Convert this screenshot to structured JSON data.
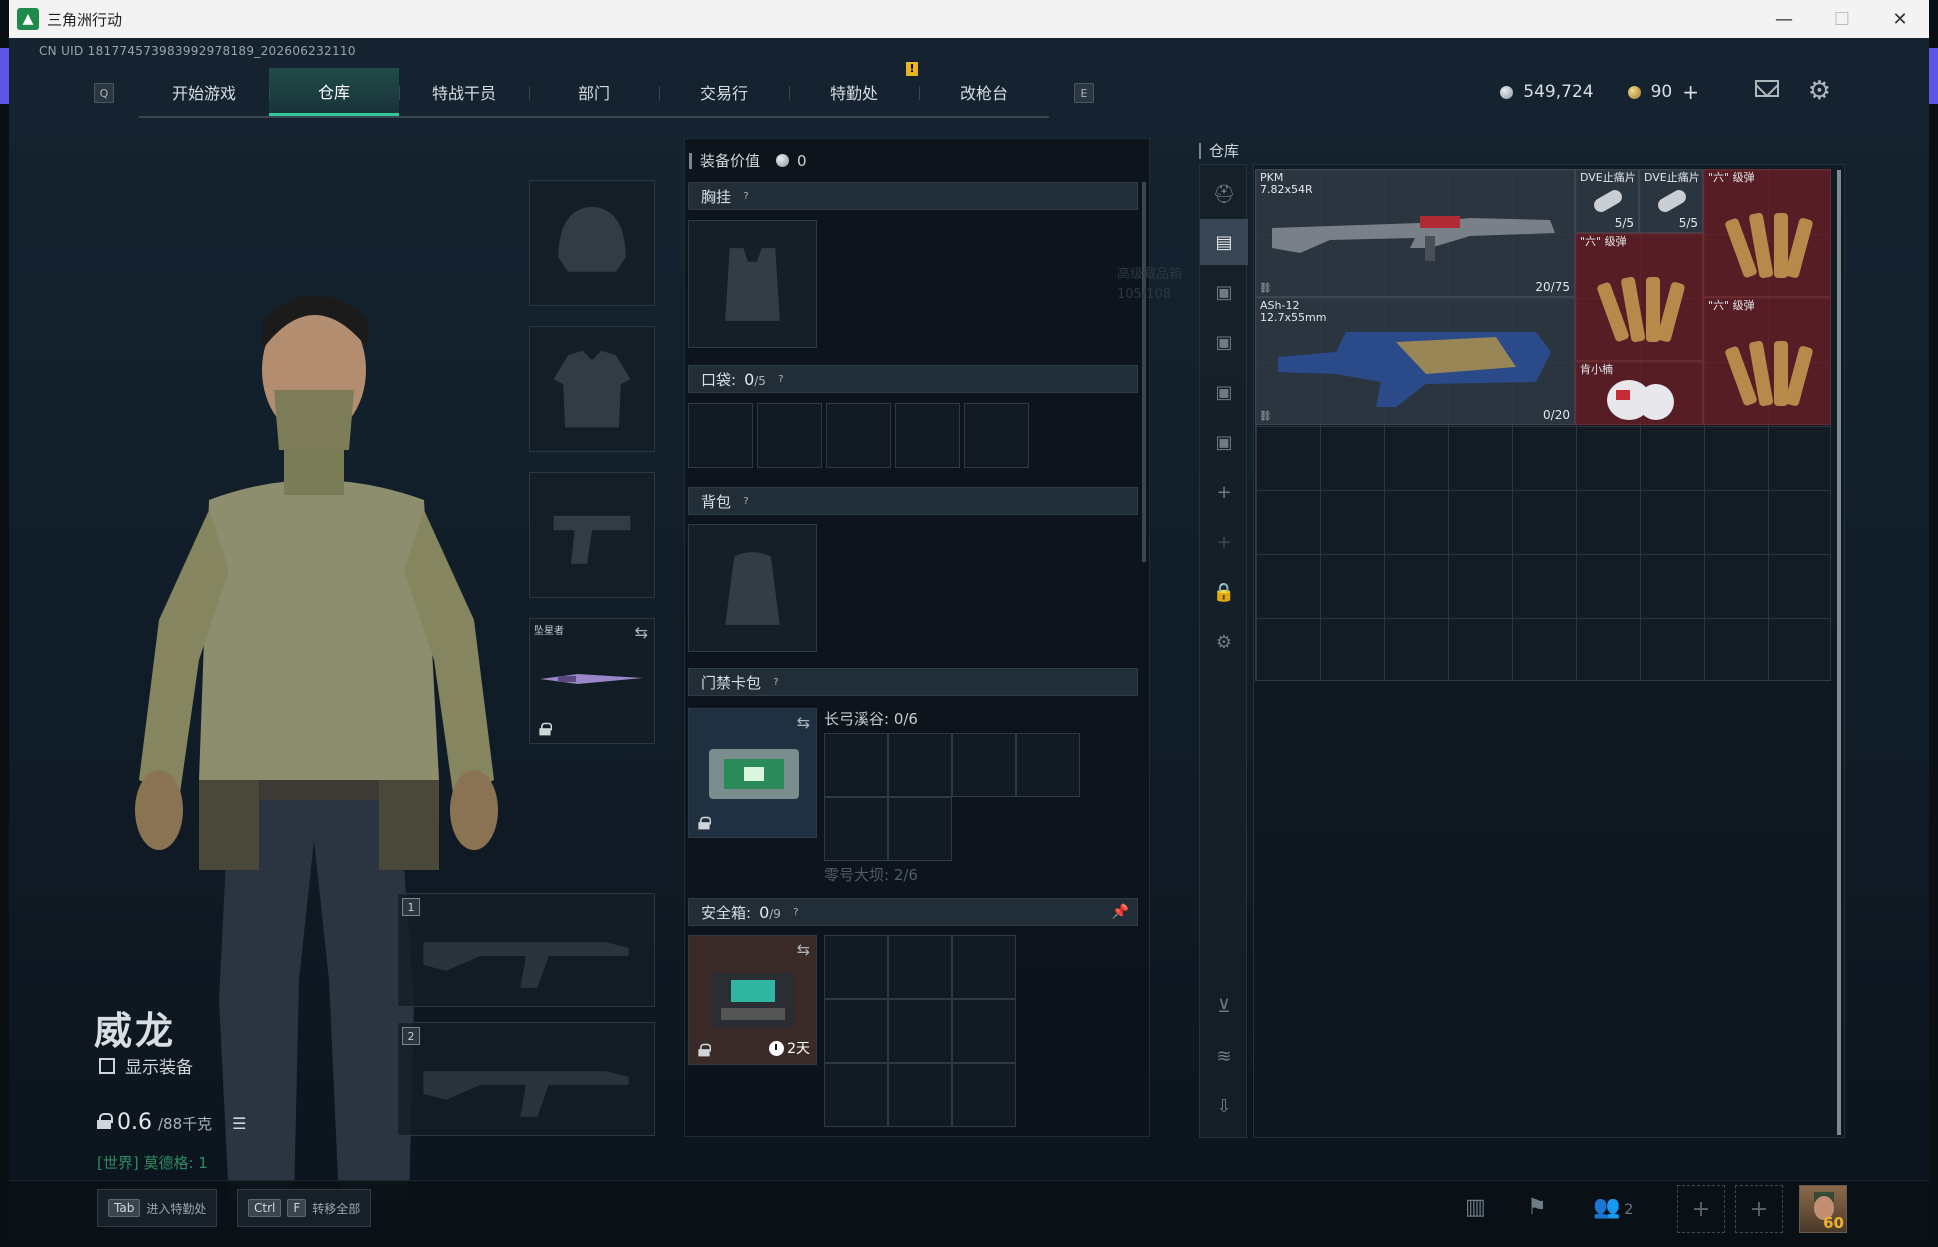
{
  "window": {
    "title": "三角洲行动",
    "minimize": "—",
    "maximize": "☐",
    "close": "✕"
  },
  "uid": "CN UID 181774573983992978189_202606232110",
  "nav": {
    "left_key": "Q",
    "right_key": "E",
    "tabs": [
      {
        "label": "开始游戏"
      },
      {
        "label": "仓库"
      },
      {
        "label": "特战干员"
      },
      {
        "label": "部门"
      },
      {
        "label": "交易行"
      },
      {
        "label": "特勤处"
      },
      {
        "label": "改枪台"
      }
    ]
  },
  "currency": {
    "silver": "549,724",
    "gold": "90",
    "plus": "+"
  },
  "operator": {
    "name": "威龙",
    "show_equipment": "显示装备",
    "weight_value": "0.6",
    "weight_max": "/88千克",
    "chat": "[世界] 莫德格: 1"
  },
  "slots": {
    "melee_label": "坠星者",
    "primary_num": "1",
    "secondary_num": "2"
  },
  "loadout": {
    "equipment_value_label": "装备价值",
    "equipment_value": "0",
    "chest_rig": "胸挂",
    "pockets": "口袋:",
    "pockets_count": "0",
    "pockets_max": "/5",
    "backpack": "背包",
    "keycard": "门禁卡包",
    "keycard_sub1": "长弓溪谷: 0/6",
    "keycard_sub2": "零号大坝: 2/6",
    "safebox": "安全箱:",
    "safebox_count": "0",
    "safebox_max": "/9",
    "safebox_timer": "2天",
    "ghost_tooltip_1": "高级藏品箱",
    "ghost_tooltip_2": "105/108"
  },
  "warehouse": {
    "title": "仓库",
    "items": [
      {
        "name": "PKM",
        "sub": "7.82x54R",
        "qty": "20/75"
      },
      {
        "name": "ASh-12",
        "sub": "12.7x55mm",
        "qty": "0/20"
      },
      {
        "name": "DVE止痛片",
        "qty": "5/5"
      },
      {
        "name": "DVE止痛片",
        "qty": "5/5"
      },
      {
        "name": "\"六\" 级弹"
      },
      {
        "name": "\"六\" 级弹"
      },
      {
        "name": "\"六\" 级弹"
      },
      {
        "name": "肯小楠"
      }
    ]
  },
  "bottom": {
    "hint1_key": "Tab",
    "hint1_label": "进入特勤处",
    "hint2_key1": "Ctrl",
    "hint2_key2": "F",
    "hint2_label": "转移全部",
    "friends_count": "2",
    "avatar_level": "60"
  },
  "colors": {
    "accent": "#35c59a",
    "alert": "#e7b524",
    "rare_item_bg": "#6e1e26"
  }
}
